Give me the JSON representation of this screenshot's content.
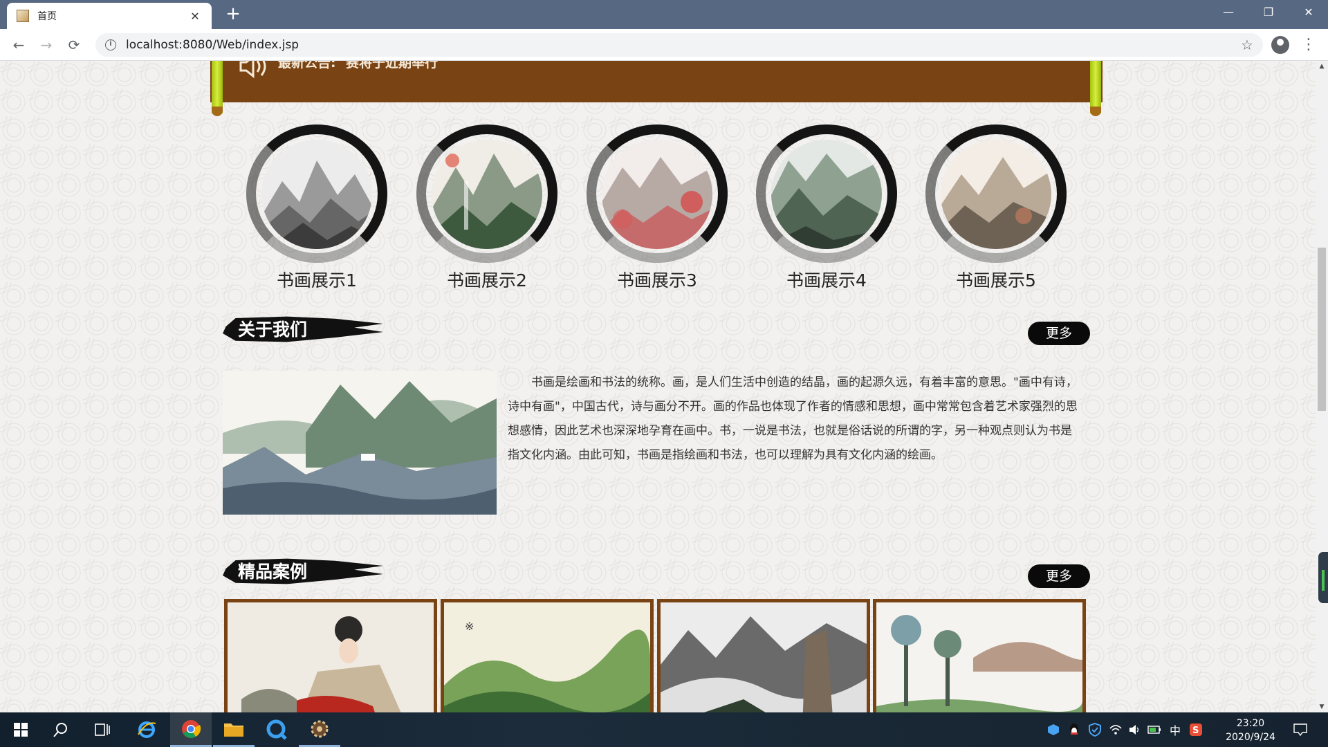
{
  "browser": {
    "tab_title": "首页",
    "new_tab_symbol": "+",
    "url": "localhost:8080/Web/index.jsp",
    "minimize": "—",
    "restore": "❐",
    "close": "✕"
  },
  "notice": {
    "label": "最新公告:",
    "text": "赛将于近期举行"
  },
  "showcase": [
    {
      "caption": "书画展示1"
    },
    {
      "caption": "书画展示2"
    },
    {
      "caption": "书画展示3"
    },
    {
      "caption": "书画展示4"
    },
    {
      "caption": "书画展示5"
    }
  ],
  "about": {
    "title": "关于我们",
    "more": "更多",
    "text": "书画是绘画和书法的统称。画，是人们生活中创造的结晶，画的起源久远，有着丰富的意思。\"画中有诗，诗中有画\"，中国古代，诗与画分不开。画的作品也体现了作者的情感和思想，画中常常包含着艺术家强烈的思想感情，因此艺术也深深地孕育在画中。书，一说是书法，也就是俗话说的所谓的字，另一种观点则认为书是指文化内涵。由此可知，书画是指绘画和书法，也可以理解为具有文化内涵的绘画。"
  },
  "cases": {
    "title": "精品案例",
    "more": "更多"
  },
  "taskbar": {
    "time": "23:20",
    "date": "2020/9/24",
    "ime": "中"
  },
  "colors": {
    "banner": "#7a4313",
    "roller": "#b6d41a",
    "tabstrip": "#566882",
    "card_border": "#7a4313"
  }
}
